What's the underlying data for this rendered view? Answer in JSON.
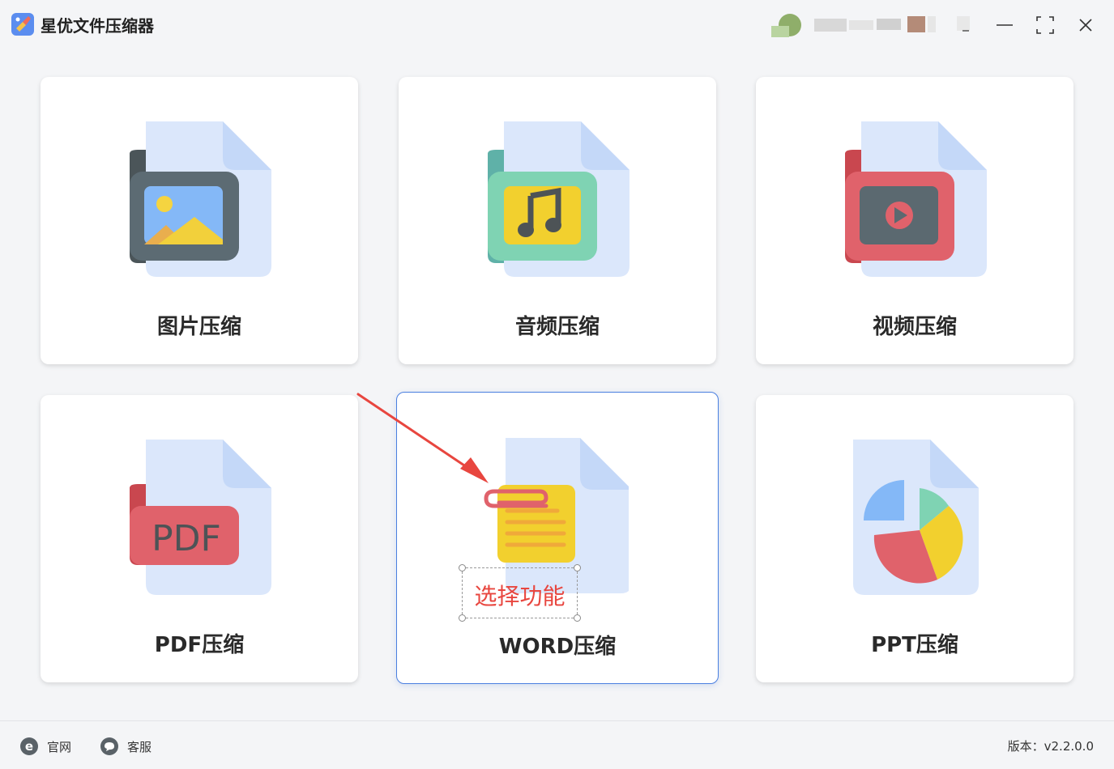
{
  "app": {
    "title": "星优文件压缩器"
  },
  "cards": {
    "image": "图片压缩",
    "audio": "音频压缩",
    "video": "视频压缩",
    "pdf": "PDF压缩",
    "word": "WORD压缩",
    "ppt": "PPT压缩"
  },
  "pdf_icon_text": "PDF",
  "annotation": {
    "callout": "选择功能"
  },
  "footer": {
    "site_label": "官网",
    "support_label": "客服",
    "version": "版本：v2.2.0.0"
  },
  "icons": {
    "app_logo": "app-logo",
    "window_controls": [
      "menu-icon",
      "minimize-icon",
      "maximize-icon",
      "close-icon"
    ]
  },
  "colors": {
    "accent": "#4a7fe0",
    "callout_red": "#e8463f",
    "file_blue": "#d9e6fb"
  }
}
